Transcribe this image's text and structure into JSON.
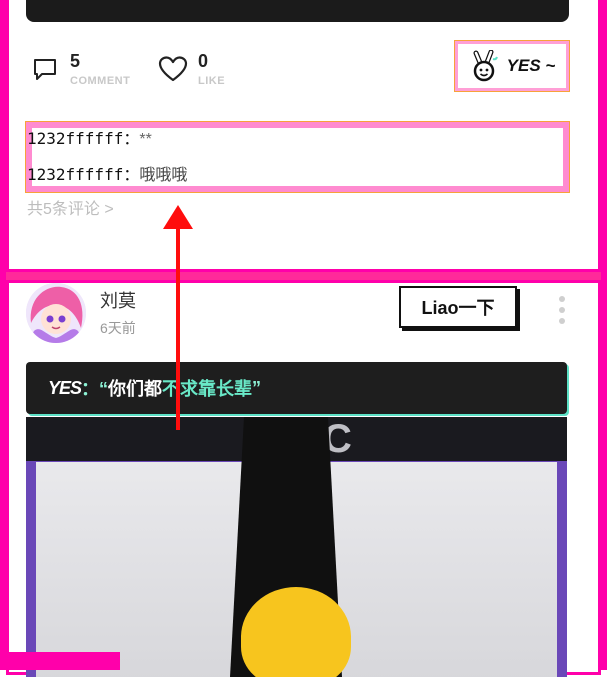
{
  "post1": {
    "comment_count": "5",
    "comment_label": "COMMENT",
    "like_count": "0",
    "like_label": "LIKE",
    "yes_label": "YES ~",
    "comments": [
      {
        "user": "1232ffffff：",
        "text": "**"
      },
      {
        "user": "1232ffffff：",
        "text": "哦哦哦"
      }
    ],
    "more_comments": "共5条评论 >"
  },
  "post2": {
    "author": "刘莫",
    "time": "6天前",
    "action_button": "Liao一下",
    "banner_prefix": "YES",
    "banner_text_a": "你们都",
    "banner_text_b": "不求靠长辈",
    "image_brand": "AOC"
  },
  "colors": {
    "debug_frame": "#ff00aa",
    "arrow": "#ff0d0d",
    "accent_mint": "#69e9c8"
  },
  "icons": [
    "comment-icon",
    "heart-icon",
    "victory-hand-icon",
    "more-vertical-icon"
  ]
}
